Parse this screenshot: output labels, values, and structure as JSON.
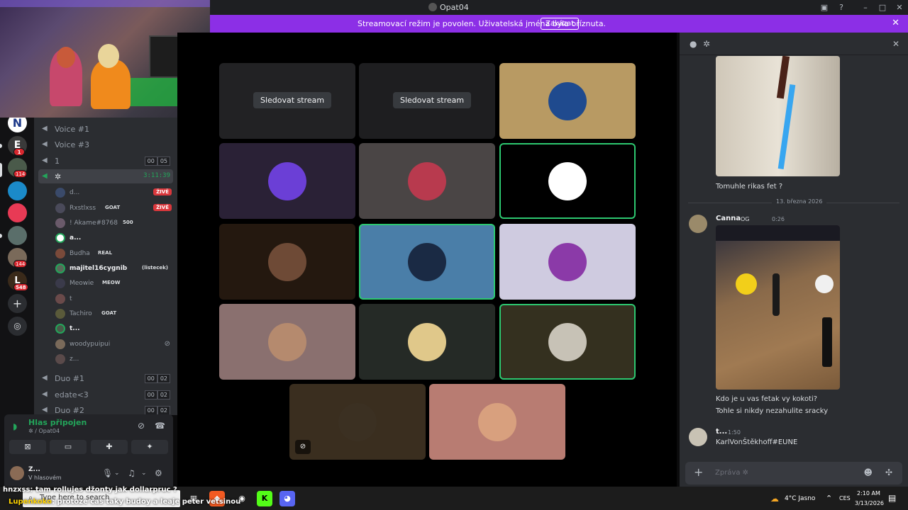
{
  "window": {
    "title": "Opat04"
  },
  "banner": {
    "text": "Streamovací režim je povolen. Uživatelská jména byla oříznuta.",
    "button": "Zakázat"
  },
  "servers": [
    {
      "letter": "N",
      "badge": ""
    },
    {
      "letter": "E",
      "badge": "1"
    },
    {
      "letter": "",
      "badge": "114"
    },
    {
      "letter": "",
      "badge": ""
    },
    {
      "letter": "",
      "badge": ""
    },
    {
      "letter": "",
      "badge": ""
    },
    {
      "letter": "",
      "badge": "144"
    },
    {
      "letter": "L",
      "badge": "548"
    }
  ],
  "channels": [
    {
      "name": "Voice #1"
    },
    {
      "name": "Voice #3"
    },
    {
      "name": "1",
      "count_a": "00",
      "count_b": "05"
    },
    {
      "name": "✲",
      "timer": "3:11:39"
    }
  ],
  "users": [
    {
      "name": "d...",
      "tag": "",
      "live": "ŽIVĚ"
    },
    {
      "name": "Rxstlxss",
      "tag": "GOAT",
      "live": "ŽIVĚ"
    },
    {
      "name": "! Akame#8768",
      "tag": "500",
      "live": ""
    },
    {
      "name": "a...",
      "tag": "",
      "live": ""
    },
    {
      "name": "Budha",
      "tag": "REAL",
      "live": ""
    },
    {
      "name": "majitel16cygnib",
      "tag": "(listecek)",
      "live": ""
    },
    {
      "name": "Meowie",
      "tag": "MEOW",
      "live": ""
    },
    {
      "name": "t",
      "tag": "",
      "live": ""
    },
    {
      "name": "Tachiro",
      "tag": "GOAT",
      "live": ""
    },
    {
      "name": "t...",
      "tag": "",
      "live": ""
    },
    {
      "name": "woodypuipui",
      "tag": "",
      "live": ""
    },
    {
      "name": "z...",
      "tag": "",
      "live": ""
    }
  ],
  "channels2": [
    {
      "name": "Duo #1",
      "count_a": "00",
      "count_b": "02"
    },
    {
      "name": "edate<3",
      "count_a": "00",
      "count_b": "02"
    },
    {
      "name": "Duo #2",
      "count_a": "00",
      "count_b": "02"
    }
  ],
  "voice_panel": {
    "status": "Hlas připojen",
    "sub": "✲ / Opat04"
  },
  "user_panel": {
    "name": "Z...",
    "status": "V hlasovém"
  },
  "stage": {
    "watch_label": "Sledovat stream",
    "tiles": [
      {
        "kind": "stream",
        "bg": "#222224"
      },
      {
        "kind": "stream",
        "bg": "#1e1e20"
      },
      {
        "kind": "avatar",
        "bg": "#b89a63",
        "avatar_color": "#1f4a8e",
        "speaking": false
      },
      {
        "kind": "avatar",
        "bg": "#2a2136",
        "avatar_color": "#6b3fd6",
        "speaking": false
      },
      {
        "kind": "avatar",
        "bg": "#4a4545",
        "avatar_color": "#b83a4e",
        "speaking": false
      },
      {
        "kind": "avatar",
        "bg": "#000000",
        "avatar_color": "#ffffff",
        "speaking": true
      },
      {
        "kind": "avatar",
        "bg": "#24180f",
        "avatar_color": "#6e4a36",
        "speaking": false
      },
      {
        "kind": "avatar",
        "bg": "#4a7ea8",
        "avatar_color": "#1a2a44",
        "speaking": true
      },
      {
        "kind": "avatar",
        "bg": "#cfcbe0",
        "avatar_color": "#8b3aa8",
        "speaking": false
      },
      {
        "kind": "avatar",
        "bg": "#8a706f",
        "avatar_color": "#b58a6e",
        "speaking": false
      },
      {
        "kind": "avatar",
        "bg": "#252a26",
        "avatar_color": "#e0c88a",
        "speaking": false
      },
      {
        "kind": "avatar",
        "bg": "#34301f",
        "avatar_color": "#c7c2b6",
        "speaking": true
      },
      {
        "kind": "avatar",
        "bg": "#3a2e1f",
        "avatar_color": "#3b3022",
        "speaking": false,
        "muted": true
      },
      {
        "kind": "avatar",
        "bg": "#b87c72",
        "avatar_color": "#d8a07e",
        "speaking": false
      }
    ]
  },
  "chat": {
    "msg1": "Tomuhle rikas fet ?",
    "date_divider": "13. března 2026",
    "m2_author": "Canna",
    "m2_badge": "OG",
    "m2_time": "0:26",
    "m2_line1": "Kdo je u vas fetak vy kokoti?",
    "m2_line2": "Tohle si nikdy nezahulite sracky",
    "m3_author": "t...",
    "m3_time": "1:50",
    "m3_text": "KarlVonŠtěkhoff#EUNE",
    "composer_placeholder": "Zpráva ✲"
  },
  "overlay": {
    "line1": "hnzxss: tam rollujes džonty jak dollarpruc ?",
    "line2_name": "Lupenkoko",
    "line2_text": ": protoze čas taky budoy a leaje peter vetsinou"
  },
  "taskbar": {
    "search_placeholder": "Type here to search",
    "weather": "4°C  Jasno",
    "lang": "CES",
    "time": "2:10 AM",
    "date": "3/13/2026"
  }
}
